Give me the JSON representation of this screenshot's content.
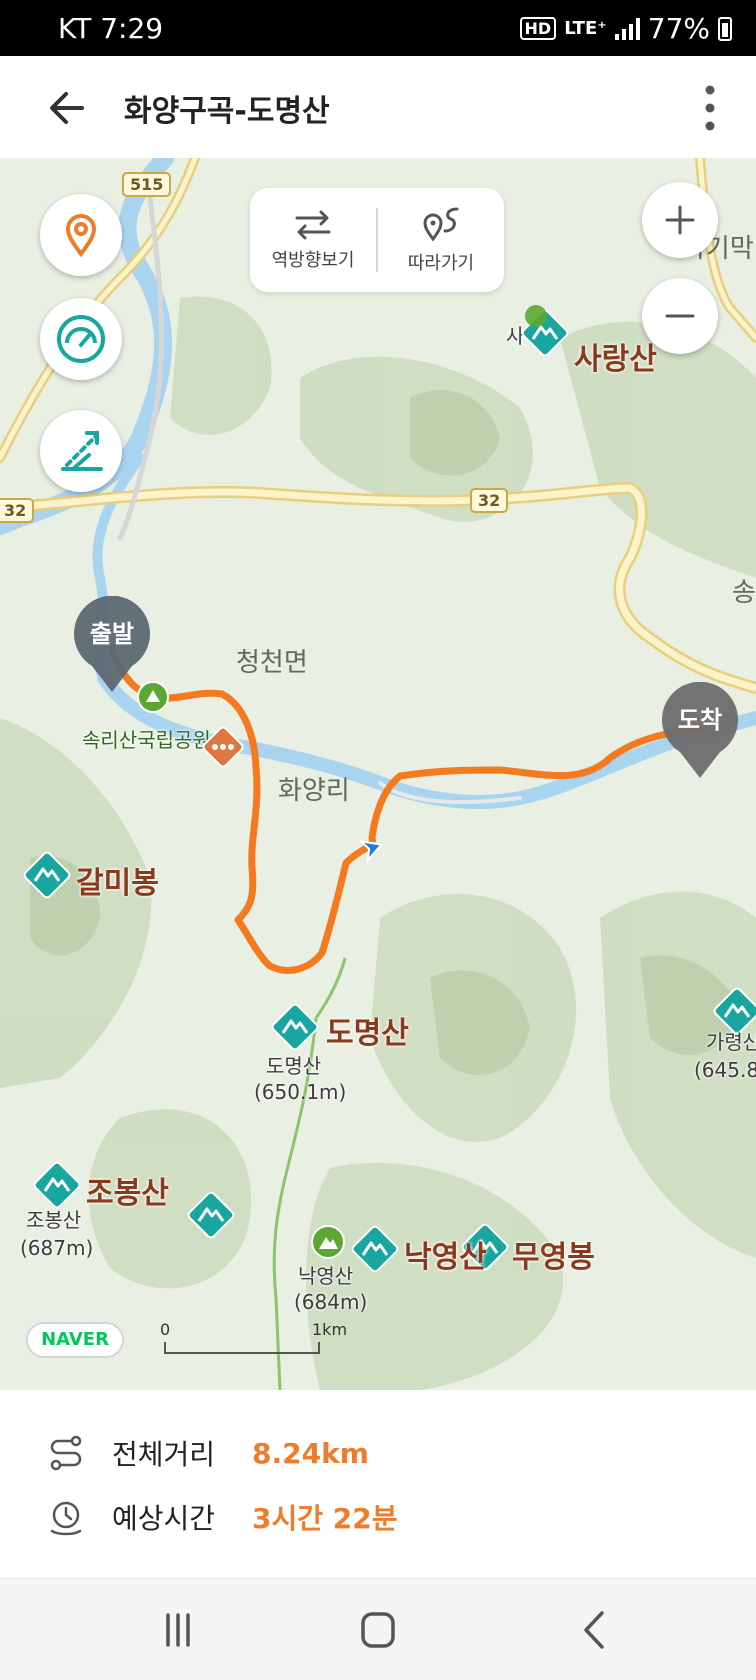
{
  "status_bar": {
    "carrier_time": "KT 7:29",
    "hd": "HD",
    "network": "LTE⁺",
    "battery": "77%"
  },
  "header": {
    "title": "화양구곡-도명산"
  },
  "map": {
    "route_toggle": {
      "reverse_label": "역방향보기",
      "follow_label": "따라가기"
    },
    "markers": {
      "start": "출발",
      "end": "도착"
    },
    "road_numbers": [
      "515",
      "32",
      "32"
    ],
    "place_labels": {
      "cheongcheon": "청천면",
      "hwayang": "화양리",
      "park": "속리산국립공원",
      "sagimak": "사기막",
      "song": "송",
      "sa_partial": "사"
    },
    "peaks": {
      "sarangsan": "사랑산",
      "galmibong": "갈미봉",
      "domyeongsan": "도명산",
      "domyeongsan_small": "도명산",
      "domyeongsan_height": "(650.1m)",
      "jobongsan": "조봉산",
      "jobongsan_small": "조봉산",
      "jobongsan_height": "(687m)",
      "nagyeongsan": "낙영산",
      "nagyeongsan_small": "낙영산",
      "nagyeongsan_height": "(684m)",
      "muyeongbong": "무영봉",
      "garyeongsan_small": "가령산",
      "garyeongsan_height": "(645.8"
    },
    "logo": "NAVER",
    "scale": {
      "zero": "0",
      "unit": "1km"
    }
  },
  "info": {
    "distance_label": "전체거리",
    "distance_value": "8.24km",
    "time_label": "예상시간",
    "time_value": "3시간 22분"
  },
  "colors": {
    "route": "#f47a20",
    "accent": "#ef7c2a",
    "teal": "#1aa6a0",
    "water": "#a9d4f0",
    "road": "#f7e7a4"
  }
}
